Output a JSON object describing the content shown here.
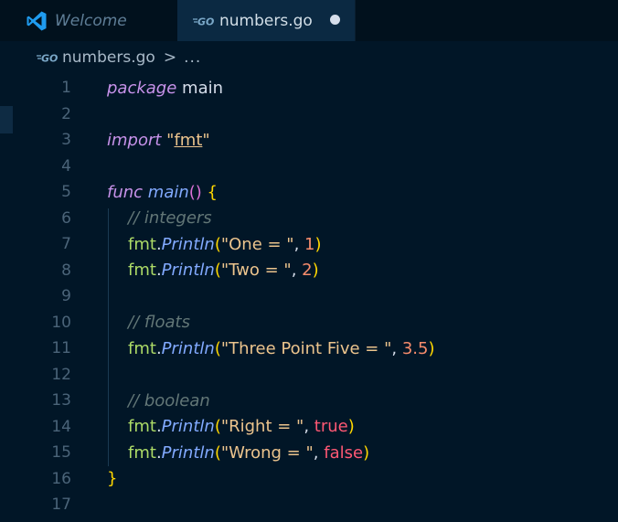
{
  "tabs": [
    {
      "label": "Welcome",
      "icon": "vscode-logo-icon",
      "active": false
    },
    {
      "label": "numbers.go",
      "icon": "go-file-icon",
      "active": true,
      "dirty": true
    }
  ],
  "breadcrumb": {
    "file": "numbers.go",
    "separator": ">",
    "more": "..."
  },
  "colors": {
    "background": "#011627",
    "keyword": "#c792ea",
    "string": "#ecc48d",
    "function": "#82aaff",
    "comment": "#637777",
    "number": "#f78c6c",
    "boolean": "#ff5874",
    "brace": "#ffd700"
  },
  "editor": {
    "line_numbers": [
      "1",
      "2",
      "3",
      "4",
      "5",
      "6",
      "7",
      "8",
      "9",
      "10",
      "11",
      "12",
      "13",
      "14",
      "15",
      "16",
      "17"
    ],
    "code": {
      "l1_kw": "package",
      "l1_name": " main",
      "l3_kw": "import",
      "l3_q1": " \"",
      "l3_pkg": "fmt",
      "l3_q2": "\"",
      "l5_kw": "func",
      "l5_fn": " main",
      "l5_parens": "()",
      "l5_brace": " {",
      "l6_comment": "// integers",
      "l7_pkg": "fmt",
      "l7_dot": ".",
      "l7_fn": "Println",
      "l7_po": "(",
      "l7_str": "\"One = \"",
      "l7_comma": ", ",
      "l7_num": "1",
      "l7_pc": ")",
      "l8_pkg": "fmt",
      "l8_dot": ".",
      "l8_fn": "Println",
      "l8_po": "(",
      "l8_str": "\"Two = \"",
      "l8_comma": ", ",
      "l8_num": "2",
      "l8_pc": ")",
      "l10_comment": "// floats",
      "l11_pkg": "fmt",
      "l11_dot": ".",
      "l11_fn": "Println",
      "l11_po": "(",
      "l11_str": "\"Three Point Five = \"",
      "l11_comma": ", ",
      "l11_num": "3.5",
      "l11_pc": ")",
      "l13_comment": "// boolean",
      "l14_pkg": "fmt",
      "l14_dot": ".",
      "l14_fn": "Println",
      "l14_po": "(",
      "l14_str": "\"Right = \"",
      "l14_comma": ", ",
      "l14_bool": "true",
      "l14_pc": ")",
      "l15_pkg": "fmt",
      "l15_dot": ".",
      "l15_fn": "Println",
      "l15_po": "(",
      "l15_str": "\"Wrong = \"",
      "l15_comma": ", ",
      "l15_bool": "false",
      "l15_pc": ")",
      "l16_brace": "}"
    }
  }
}
